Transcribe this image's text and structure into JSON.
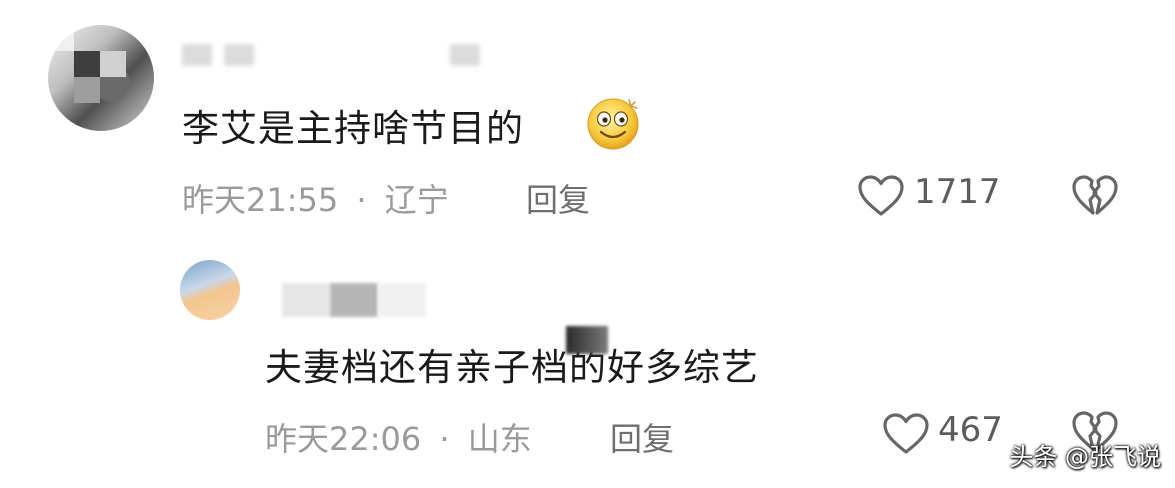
{
  "comments": [
    {
      "text": "李艾是主持啥节目的",
      "emoji": "smiling-face-emoji",
      "time": "昨天21:55",
      "separator": "·",
      "location": "辽宁",
      "reply_label": "回复",
      "likes": "1717"
    },
    {
      "text": "夫妻档还有亲子档的好多综艺",
      "time": "昨天22:06",
      "separator": "·",
      "location": "山东",
      "reply_label": "回复",
      "likes": "467"
    }
  ],
  "watermark": "头条 @张飞说",
  "colors": {
    "text": "#1a1a1a",
    "meta": "#9a9a9a",
    "icon": "#666666"
  }
}
